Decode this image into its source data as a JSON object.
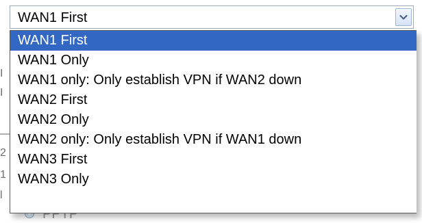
{
  "wan_select": {
    "value": "WAN1 First",
    "options": [
      "WAN1 First",
      "WAN1 Only",
      "WAN1 only: Only establish VPN if WAN2 down",
      "WAN2 First",
      "WAN2 Only",
      "WAN2 only: Only establish VPN if WAN1 down",
      "WAN3 First",
      "WAN3 Only"
    ],
    "selected_index": 0
  },
  "background_form": {
    "radio_label": "PPTP"
  },
  "icons": {
    "select_arrow": "chevron-down-icon",
    "radio": "radio-button-icon"
  },
  "colors": {
    "selected_bg": "#3267c4",
    "selected_text": "#ffffff",
    "border": "#9fa7b5"
  }
}
